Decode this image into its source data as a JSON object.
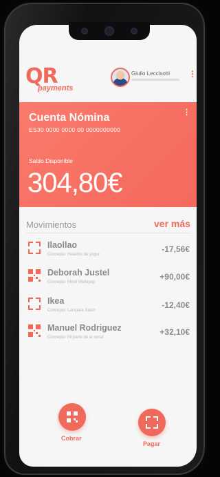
{
  "brand": {
    "logo_main": "QR",
    "logo_sub": "payments",
    "accent": "#f06a5c"
  },
  "user": {
    "name": "Giulio Leccisotti"
  },
  "account": {
    "title": "Cuenta Nómina",
    "iban": "ES30 0000 0000 00 0000000000",
    "balance_label": "Saldo Disponible",
    "balance": "304,80€"
  },
  "movements": {
    "title": "Movimientos",
    "more_label": "ver más",
    "items": [
      {
        "name": "Ilaollao",
        "concept": "Concepto: Helados de yogur",
        "amount": "-17,56€",
        "icon": "frame-icon"
      },
      {
        "name": "Deborah Justel",
        "concept": "Concepto: Móvil Wallapop",
        "amount": "+90,00€",
        "icon": "qr-code-icon"
      },
      {
        "name": "Ikea",
        "concept": "Concepto: Lampara Salón",
        "amount": "-12,40€",
        "icon": "frame-icon"
      },
      {
        "name": "Manuel Rodriguez",
        "concept": "Concepto: Mi parte de la cena!",
        "amount": "+32,10€",
        "icon": "qr-code-icon"
      }
    ]
  },
  "actions": {
    "charge_label": "Cobrar",
    "pay_label": "Pagar"
  }
}
